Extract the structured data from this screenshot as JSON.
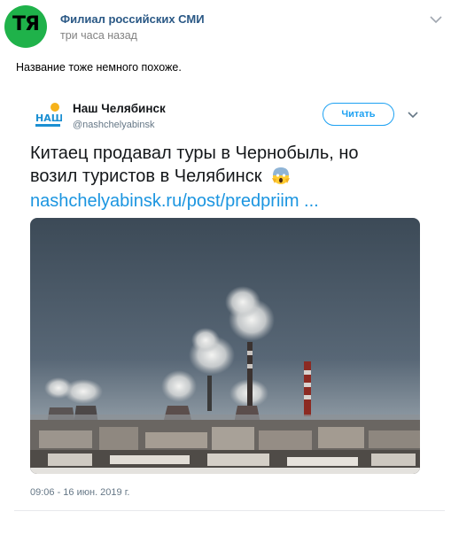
{
  "post": {
    "author": "Филиал российских СМИ",
    "time": "три часа назад",
    "avatar_text": "ТЯ",
    "text": "Название тоже немного похоже."
  },
  "tweet": {
    "name": "Наш Челябинск",
    "handle": "@nashchelyabinsk",
    "follow_label": "Читать",
    "text_line1": "Китаец продавал туры в Чернобыль, но",
    "text_line2": "возил туристов в Челябинск",
    "link": "nashchelyabinsk.ru/post/predpriim  ...",
    "date": "09:06 - 16 июн. 2019 г.",
    "logo_text": "НАШ"
  },
  "colors": {
    "avatar_green": "#1fb24a",
    "author_link": "#2a5885",
    "twitter_blue": "#1da1f2",
    "link_blue": "#1b95e0"
  },
  "icons": [
    "chevron-down-icon",
    "scream-emoji-icon",
    "account-logo-icon"
  ]
}
